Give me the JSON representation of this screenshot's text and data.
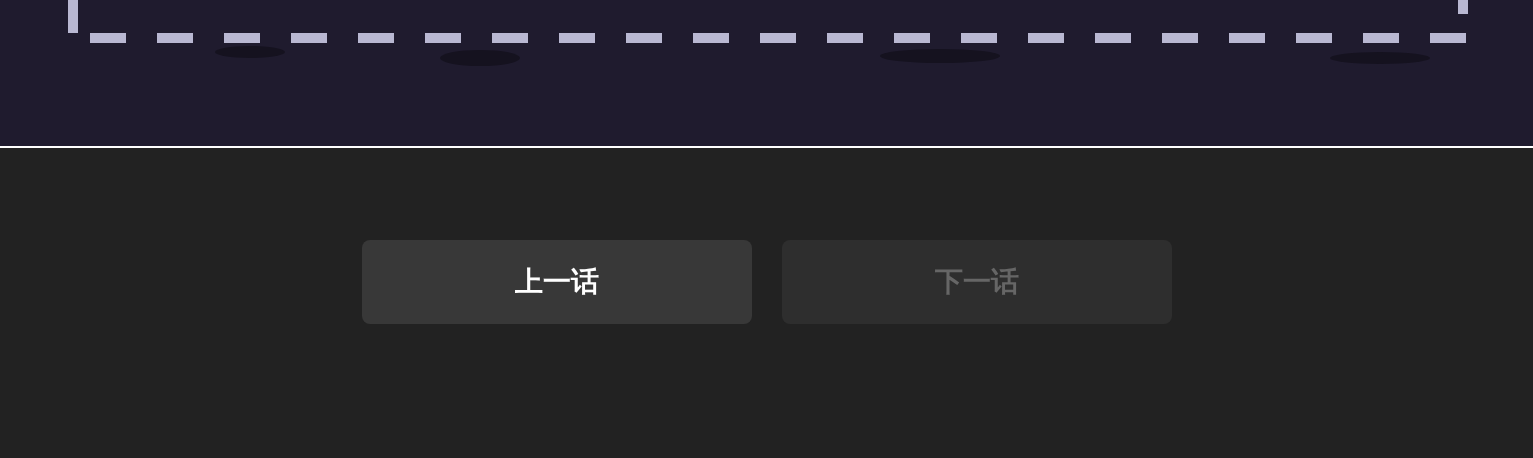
{
  "buttons": [
    {
      "label": "上一话",
      "disabled": false
    },
    {
      "label": "下一话",
      "disabled": true
    }
  ]
}
